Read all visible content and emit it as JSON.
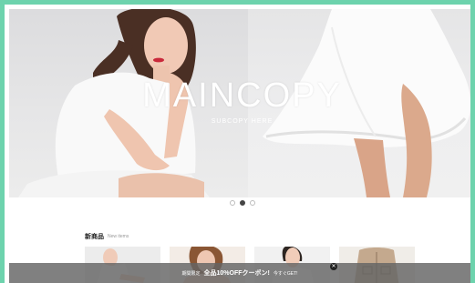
{
  "hero": {
    "main_copy": "MAINCOPY",
    "sub_copy": "SUBCOPY HERE",
    "active_slide": 2,
    "slides": [
      "slide-1",
      "slide-2",
      "slide-3"
    ]
  },
  "new_items": {
    "heading": "新商品",
    "sub_heading": "New items"
  },
  "coupon": {
    "prefix": "期間限定",
    "offer": "全品10%OFFクーポン!",
    "cta": "今すぐGET!",
    "close_icon": "close-icon"
  },
  "colors": {
    "frame": "#6dd3ad",
    "coupon_bar": "#666666"
  }
}
